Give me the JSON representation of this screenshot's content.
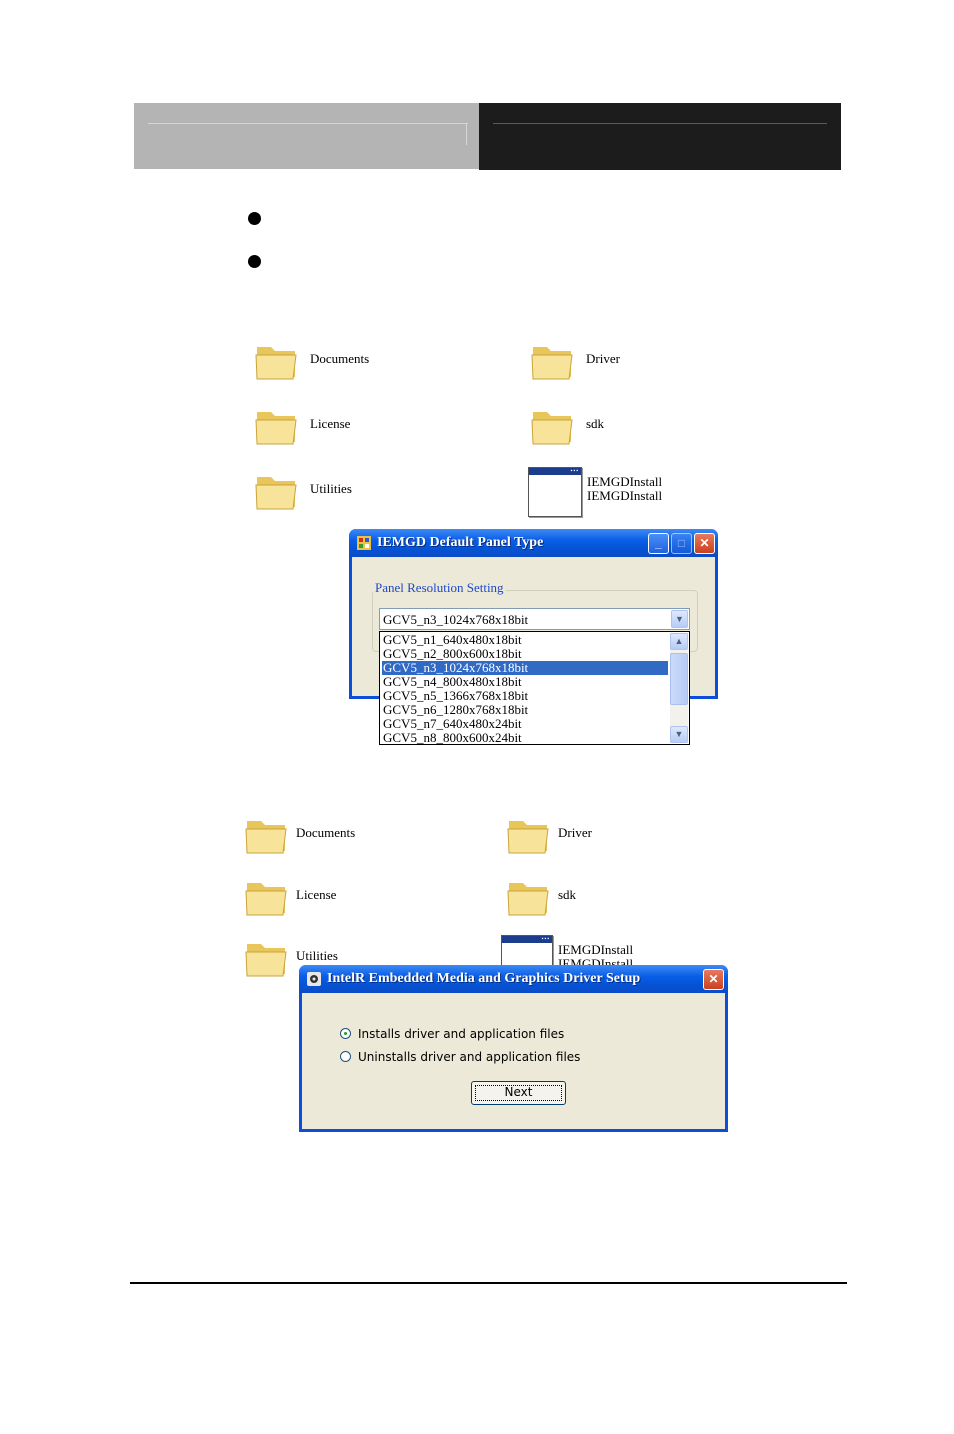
{
  "panel1": {
    "items": [
      {
        "label": "Documents"
      },
      {
        "label": "Driver"
      },
      {
        "label": "License"
      },
      {
        "label": "sdk"
      },
      {
        "label": "Utilities"
      }
    ],
    "app": {
      "line1": "IEMGDInstall",
      "line2": "IEMGDInstall"
    },
    "dialog": {
      "title": "IEMGD Default Panel Type",
      "group_label": "Panel Resolution Setting",
      "selected_value": "GCV5_n3_1024x768x18bit",
      "options": [
        "GCV5_n1_640x480x18bit",
        "GCV5_n2_800x600x18bit",
        "GCV5_n3_1024x768x18bit",
        "GCV5_n4_800x480x18bit",
        "GCV5_n5_1366x768x18bit",
        "GCV5_n6_1280x768x18bit",
        "GCV5_n7_640x480x24bit",
        "GCV5_n8_800x600x24bit"
      ]
    }
  },
  "panel2": {
    "items": [
      {
        "label": "Documents"
      },
      {
        "label": "Driver"
      },
      {
        "label": "License"
      },
      {
        "label": "sdk"
      },
      {
        "label": "Utilities"
      }
    ],
    "app": {
      "line1": "IEMGDInstall",
      "line2": "IEMGDInstall"
    },
    "dialog": {
      "title": "IntelR Embedded Media and Graphics Driver Setup",
      "option_install": "Installs driver and application files",
      "option_uninstall": "Uninstalls driver and application files",
      "next_label": "Next"
    }
  }
}
